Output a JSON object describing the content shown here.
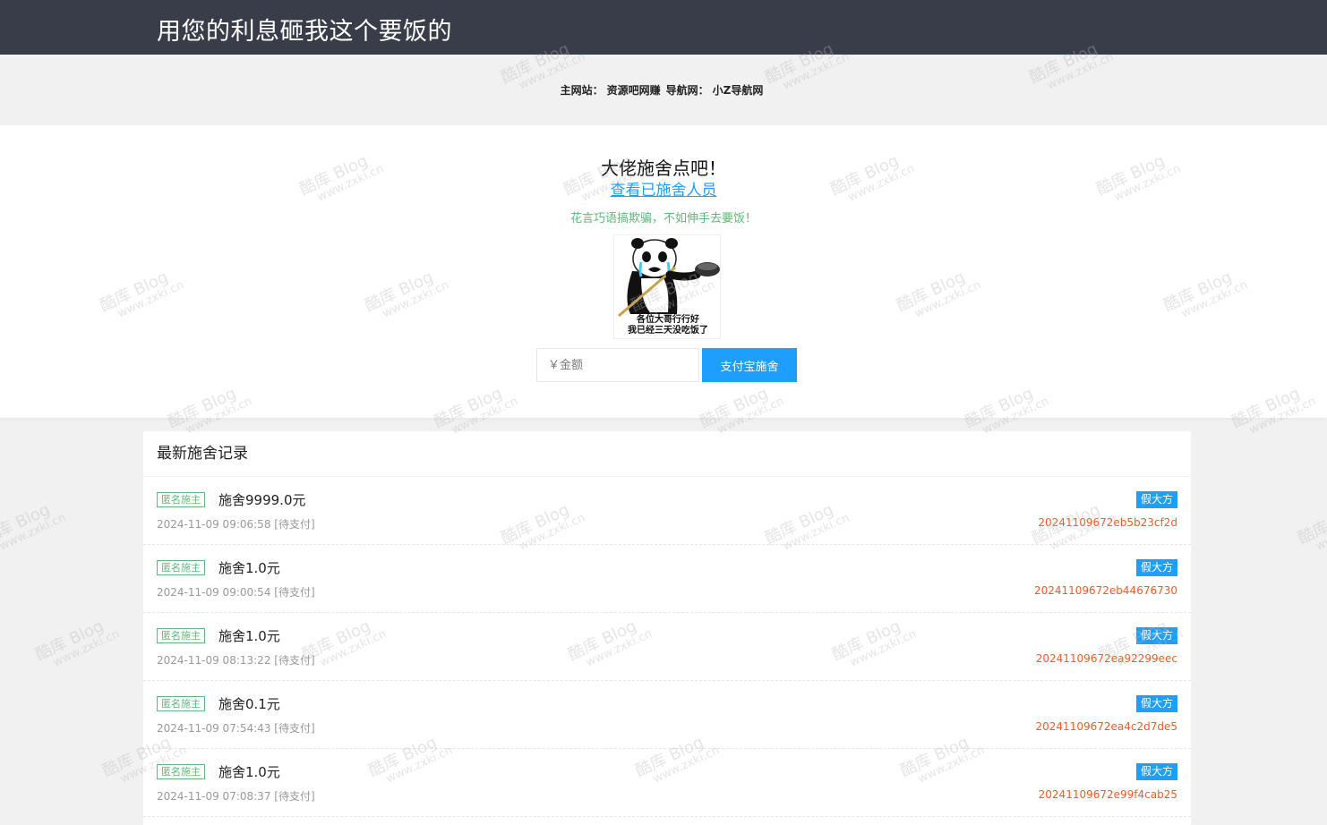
{
  "header": {
    "title": "用您的利息砸我这个要饭的"
  },
  "sites": {
    "main_label": "主网站：",
    "main_value": "资源吧网赚",
    "nav_label": "导航网：",
    "nav_value": "小Z导航网"
  },
  "hero": {
    "heading": "大佬施舍点吧！",
    "donor_link": "查看已施舍人员",
    "slogan": "花言巧语搞欺骗，不如伸手去要饭！",
    "meme_caption_line1": "各位大哥行行好",
    "meme_caption_line2": "我已经三天没吃饭了",
    "amount_placeholder": "￥金额",
    "pay_button": "支付宝施舍"
  },
  "records": {
    "title": "最新施舍记录",
    "items": [
      {
        "badge": "匿名施主",
        "amount": "施舍9999.0元",
        "time": "2024-11-09 09:06:58",
        "status": "[待支付]",
        "tag": "假大方",
        "order": "20241109672eb5b23cf2d"
      },
      {
        "badge": "匿名施主",
        "amount": "施舍1.0元",
        "time": "2024-11-09 09:00:54",
        "status": "[待支付]",
        "tag": "假大方",
        "order": "20241109672eb44676730"
      },
      {
        "badge": "匿名施主",
        "amount": "施舍1.0元",
        "time": "2024-11-09 08:13:22",
        "status": "[待支付]",
        "tag": "假大方",
        "order": "20241109672ea92299eec"
      },
      {
        "badge": "匿名施主",
        "amount": "施舍0.1元",
        "time": "2024-11-09 07:54:43",
        "status": "[待支付]",
        "tag": "假大方",
        "order": "20241109672ea4c2d7de5"
      },
      {
        "badge": "匿名施主",
        "amount": "施舍1.0元",
        "time": "2024-11-09 07:08:37",
        "status": "[待支付]",
        "tag": "假大方",
        "order": "20241109672e99f4cab25"
      }
    ]
  },
  "watermark": {
    "line1": "酷库 Blog",
    "line2": "www.zxki.cn"
  },
  "colors": {
    "topbar": "#393d49",
    "accent": "#1e9fff",
    "green": "#5fb878",
    "order": "#ff5722"
  }
}
